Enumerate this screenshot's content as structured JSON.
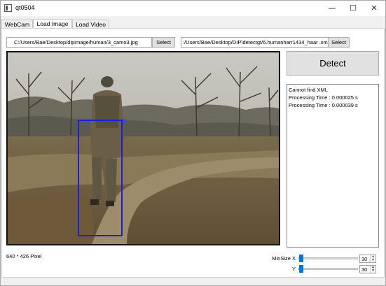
{
  "window": {
    "title": "qt0504",
    "minimize_glyph": "—",
    "maximize_glyph": "☐",
    "close_glyph": "✕"
  },
  "tabs": [
    {
      "label": "WebCam",
      "active": false
    },
    {
      "label": "Load Image",
      "active": true
    },
    {
      "label": "Load Video",
      "active": false
    }
  ],
  "image_path": {
    "value": "C:/Users/Bae/Desktop/dipimage/human/3_camo3.jpg",
    "button_label": "Select"
  },
  "xml_path": {
    "value": ":/Users/Bae/Desktop/DIP\\detectgt/6.humanharr1434_haar .xm",
    "button_label": "Select"
  },
  "detect_button": {
    "label": "Detect"
  },
  "log": [
    "Cannot find XML",
    "Processing Time : 0.000025 s",
    "Processing Time : 0.000039 s"
  ],
  "image_info": "640 * 426 Pixel",
  "min_size": {
    "x_label": "MinSize X",
    "y_label": "Y",
    "x_value": "30",
    "y_value": "30",
    "x_slider_fraction": 0.02,
    "y_slider_fraction": 0.02
  },
  "colors": {
    "detection_box": "#1f1fd0",
    "slider_handle": "#0078d7"
  },
  "icons": {
    "app": "app-window-icon",
    "spin_up": "▲",
    "spin_down": "▼"
  }
}
